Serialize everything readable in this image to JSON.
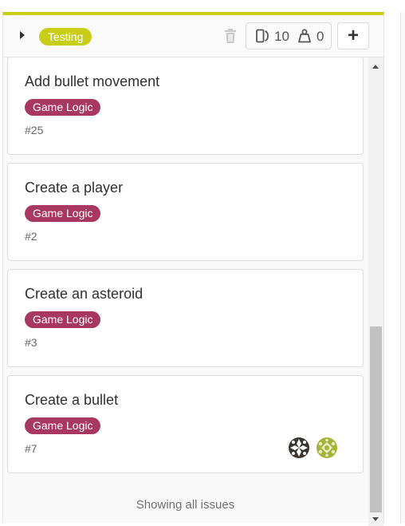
{
  "column": {
    "accent_color": "#c8cd17",
    "list_label": {
      "text": "Testing",
      "color": "#c8cd17"
    },
    "delete_icon": "trash-icon",
    "issue_count_icon": "issues-icon",
    "issue_count": "10",
    "weight_icon": "weight-icon",
    "weight_count": "0",
    "add_button_label": "+",
    "collapse_icon": "caret-right-icon"
  },
  "cards": [
    {
      "title": "Add bullet movement",
      "label": "Game Logic",
      "label_color": "#a8385f",
      "number": "#25",
      "assignees": []
    },
    {
      "title": "Create a player",
      "label": "Game Logic",
      "label_color": "#a8385f",
      "number": "#2",
      "assignees": []
    },
    {
      "title": "Create an asteroid",
      "label": "Game Logic",
      "label_color": "#a8385f",
      "number": "#3",
      "assignees": []
    },
    {
      "title": "Create a bullet",
      "label": "Game Logic",
      "label_color": "#a8385f",
      "number": "#7",
      "assignees": [
        "identicon-dark-avatar",
        "identicon-olive-avatar"
      ]
    }
  ],
  "footer": {
    "text": "Showing all issues"
  }
}
